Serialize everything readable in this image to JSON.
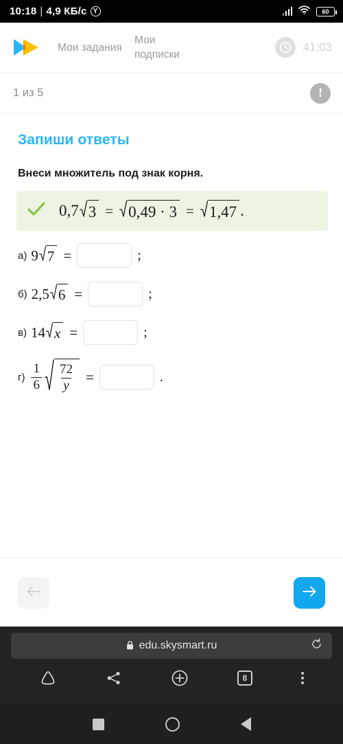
{
  "status_bar": {
    "time": "10:18",
    "separator": "|",
    "data_rate": "4,9 КБ/с",
    "assistant_icon_letter": "Y",
    "battery_level": "60"
  },
  "header": {
    "logo_name": "skysmart-logo",
    "nav": [
      {
        "label": "Мои задания"
      },
      {
        "label": "Мои подписки"
      }
    ],
    "timer": "41:03"
  },
  "progress": {
    "counter": "1 из 5",
    "warning_icon_glyph": "!"
  },
  "task": {
    "title": "Запиши ответы",
    "prompt": "Внеси множитель под знак корня.",
    "example": {
      "check_icon": "check-icon",
      "coefficient": "0,7",
      "radicand_1": "3",
      "equals": "=",
      "radicand_2": "0,49 · 3",
      "equals_2": "=",
      "radicand_3": "1,47",
      "period": "."
    },
    "items": [
      {
        "label": "а)",
        "coefficient": "9",
        "radicand": "7",
        "equals": "=",
        "value": "",
        "placeholder": "",
        "punct": ";"
      },
      {
        "label": "б)",
        "coefficient": "2,5",
        "radicand": "6",
        "equals": "=",
        "value": "",
        "placeholder": "",
        "punct": ";"
      },
      {
        "label": "в)",
        "coefficient": "14",
        "radicand": "x",
        "equals": "=",
        "value": "",
        "placeholder": "",
        "punct": ";"
      },
      {
        "label": "г)",
        "coefficient_num": "1",
        "coefficient_den": "6",
        "radicand_num": "72",
        "radicand_den": "y",
        "equals": "=",
        "value": "",
        "placeholder": "",
        "punct": "."
      }
    ]
  },
  "footer_nav": {
    "prev_label": "←",
    "next_label": "→"
  },
  "browser": {
    "lock_icon": "lock-icon",
    "url": "edu.skysmart.ru",
    "reload_icon": "reload-icon",
    "tools": [
      {
        "name": "home-icon"
      },
      {
        "name": "share-icon"
      },
      {
        "name": "new-tab-icon"
      },
      {
        "name": "tab-count",
        "label": "8"
      },
      {
        "name": "menu-icon"
      }
    ]
  },
  "system_nav": {
    "recents": "recents-button",
    "home": "home-button",
    "back": "back-button"
  },
  "colors": {
    "accent": "#29b6f6",
    "next_button": "#13a7ef",
    "example_bg": "#eef4e3",
    "check_green": "#8bc34a"
  }
}
